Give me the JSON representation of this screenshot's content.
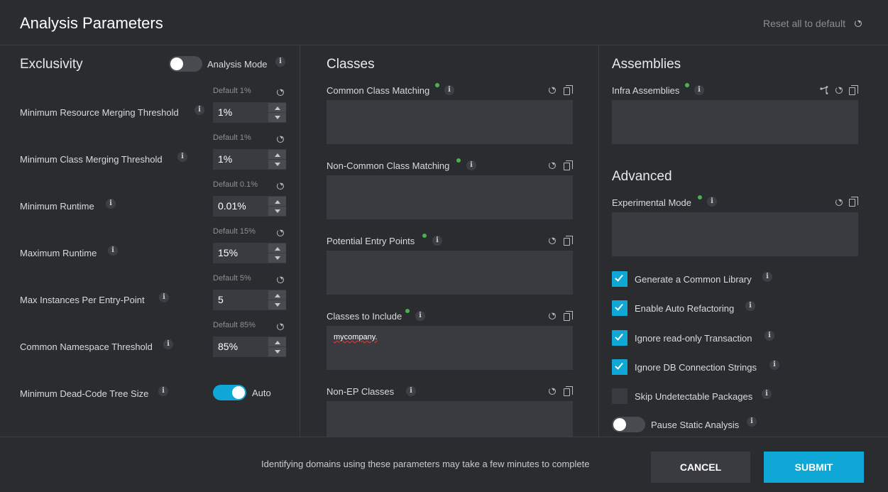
{
  "header": {
    "title": "Analysis Parameters",
    "reset_all_label": "Reset all to default"
  },
  "exclusivity": {
    "title": "Exclusivity",
    "analysis_mode_label": "Analysis Mode",
    "analysis_mode_on": false,
    "params": [
      {
        "label": "Minimum Resource Merging Threshold",
        "default": "Default 1%",
        "value": "1%"
      },
      {
        "label": "Minimum Class Merging Threshold",
        "default": "Default 1%",
        "value": "1%"
      },
      {
        "label": "Minimum Runtime",
        "default": "Default 0.1%",
        "value": "0.01%"
      },
      {
        "label": "Maximum Runtime",
        "default": "Default 15%",
        "value": "15%"
      },
      {
        "label": "Max Instances Per Entry-Point",
        "default": "Default 5%",
        "value": "5"
      },
      {
        "label": "Common Namespace Threshold",
        "default": "Default 85%",
        "value": "85%"
      }
    ],
    "dead_code_label": "Minimum Dead-Code Tree Size",
    "dead_code_toggle_label": "Auto",
    "dead_code_on": true
  },
  "classes": {
    "title": "Classes",
    "fields": [
      {
        "label": "Common Class Matching",
        "value": ""
      },
      {
        "label": "Non-Common Class Matching",
        "value": ""
      },
      {
        "label": "Potential Entry Points",
        "value": ""
      },
      {
        "label": "Classes to Include",
        "value": "mycompany."
      },
      {
        "label": "Non-EP Classes",
        "value": ""
      }
    ]
  },
  "assemblies": {
    "title": "Assemblies",
    "infra_label": "Infra Assemblies",
    "infra_value": ""
  },
  "advanced": {
    "title": "Advanced",
    "experimental_label": "Experimental Mode",
    "experimental_value": "",
    "checkboxes": [
      {
        "label": "Generate a Common Library",
        "checked": true
      },
      {
        "label": "Enable Auto Refactoring",
        "checked": true
      },
      {
        "label": "Ignore read-only Transaction",
        "checked": true
      },
      {
        "label": "Ignore DB Connection Strings",
        "checked": true
      },
      {
        "label": "Skip Undetectable Packages",
        "checked": false
      }
    ],
    "pause_label": "Pause Static Analysis",
    "pause_on": false
  },
  "footer": {
    "note": "Identifying domains using these parameters may take a few minutes to complete",
    "cancel_label": "CANCEL",
    "submit_label": "SUBMIT"
  },
  "colors": {
    "accent": "#0fa7d6",
    "background": "#2b2c30",
    "field": "#3a3b40",
    "modified_dot": "#4caf50"
  },
  "icons": {
    "info": "i",
    "reset": "refresh-icon",
    "copy": "copy-icon",
    "tree": "tree-icon"
  }
}
